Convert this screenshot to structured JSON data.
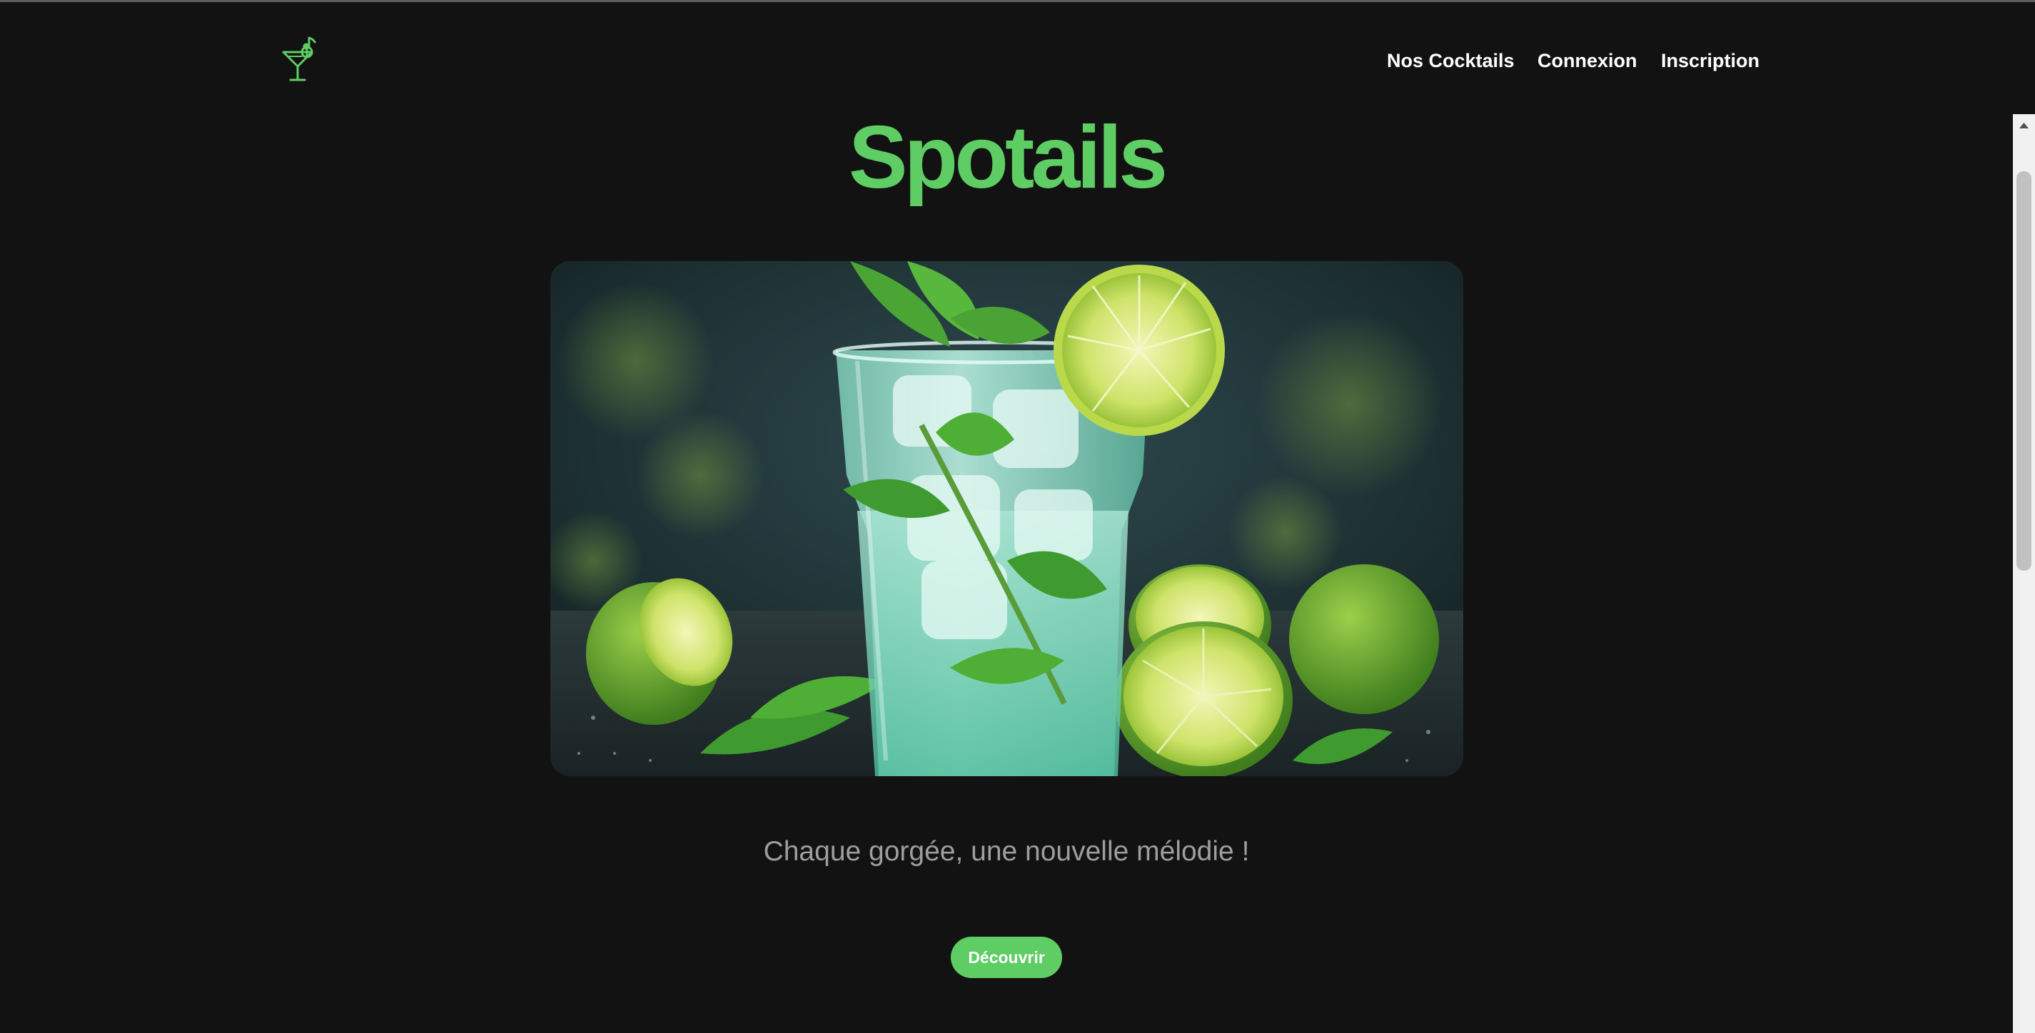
{
  "header": {
    "logo_icon": "cocktail-glass-music-note-icon",
    "nav": [
      {
        "label": "Nos Cocktails"
      },
      {
        "label": "Connexion"
      },
      {
        "label": "Inscription"
      }
    ]
  },
  "hero": {
    "title": "Spotails",
    "image_alt": "Mojito glass with mint leaves, ice and lime slices",
    "tagline": "Chaque gorgée, une nouvelle mélodie !",
    "cta_label": "Découvrir"
  },
  "colors": {
    "background": "#121212",
    "accent": "#5ecd63",
    "nav_text": "#ffffff",
    "tagline_text": "#9e9e9e"
  }
}
